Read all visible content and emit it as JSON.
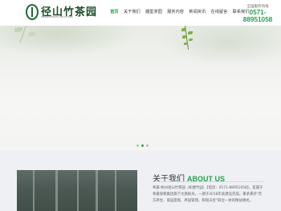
{
  "logo": {
    "name": "径山竹茶园",
    "subtitle": "JINGSHANZHUCHAYUAN"
  },
  "nav": {
    "items": [
      {
        "label": "首页",
        "active": true
      },
      {
        "label": "关于我们",
        "active": false
      },
      {
        "label": "履型茶园",
        "active": false
      },
      {
        "label": "服务内容",
        "active": false
      },
      {
        "label": "新闻资讯",
        "active": false
      },
      {
        "label": "在线留言",
        "active": false
      },
      {
        "label": "联系我们",
        "active": false
      }
    ]
  },
  "hotline": {
    "label": "全国服务热线",
    "number": "0571-88951058"
  },
  "banner": {
    "slides": 3,
    "active_slide": 2
  },
  "about": {
    "title_cn": "关于我们",
    "title_en": "ABOUT US",
    "text": "奉豪·杭州径山竹茶园（如厘竹园）【电话：0571-88951058】，是属于奉豪保税集团旗下文旅板块，一期于2018年底建设完成。秉承秉持\"苏方养生、家园度假、养园管理、和谐天伦\"四位一体的精益模式。"
  },
  "colors": {
    "accent": "#23a24d",
    "logo_dark": "#1b4d2a"
  }
}
